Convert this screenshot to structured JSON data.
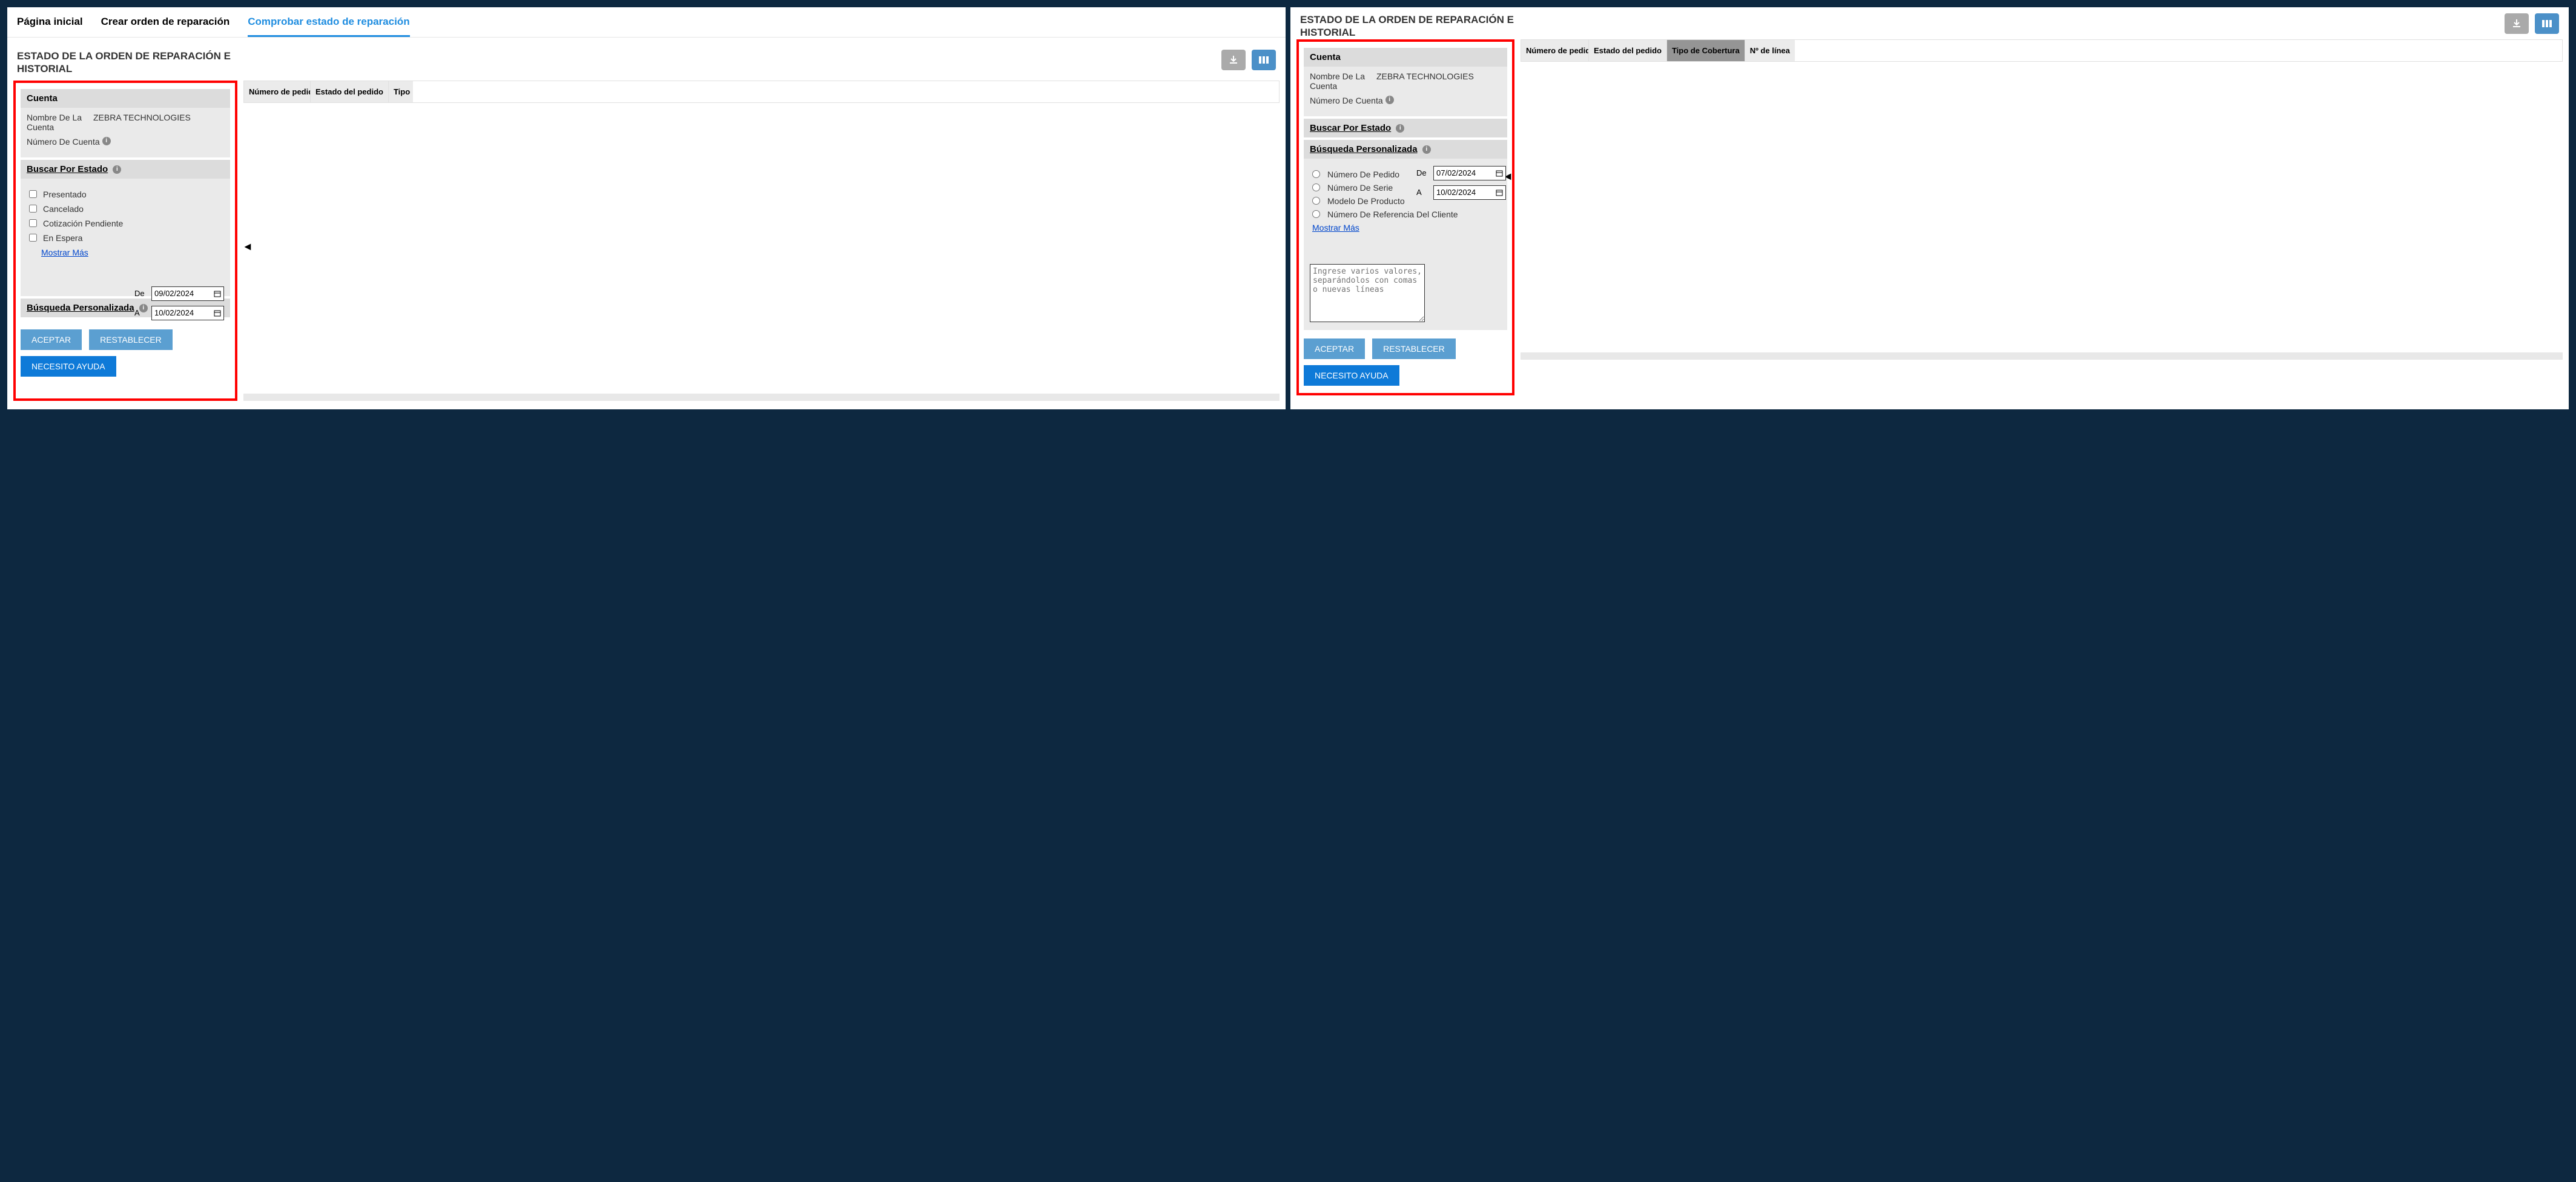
{
  "nav": {
    "tab1": "Página inicial",
    "tab2": "Crear orden de reparación",
    "tab3": "Comprobar estado de reparación"
  },
  "title": "ESTADO DE LA ORDEN DE REPARACIÓN E HISTORIAL",
  "account": {
    "head": "Cuenta",
    "name_label": "Nombre De La Cuenta",
    "name_value": "ZEBRA TECHNOLOGIES",
    "number_label": "Número De Cuenta"
  },
  "search_status": {
    "head": "Buscar Por Estado",
    "opt1": "Presentado",
    "opt2": "Cancelado",
    "opt3": "Cotización Pendiente",
    "opt4": "En Espera",
    "from": "De",
    "to": "A",
    "date_from_1": "09/02/2024",
    "date_to_1": "10/02/2024",
    "show_more": "Mostrar Más"
  },
  "custom_search": {
    "head": "Búsqueda Personalizada",
    "r1": "Número De Pedido",
    "r2": "Número De Serie",
    "r3": "Modelo De Producto",
    "r4": "Número De Referencia Del Cliente",
    "from": "De",
    "to": "A",
    "date_from_2": "07/02/2024",
    "date_to_2": "10/02/2024",
    "placeholder": "Ingrese varios valores, separándolos con comas o nuevas líneas",
    "show_more": "Mostrar Más"
  },
  "buttons": {
    "accept": "ACEPTAR",
    "reset": "RESTABLECER",
    "help": "NECESITO AYUDA"
  },
  "table": {
    "c1": "Número de pedido",
    "c2": "Estado del pedido",
    "c3": "Tipo de Cobertura",
    "c4": "Nº de línea",
    "c3_trunc": "Tipo"
  }
}
